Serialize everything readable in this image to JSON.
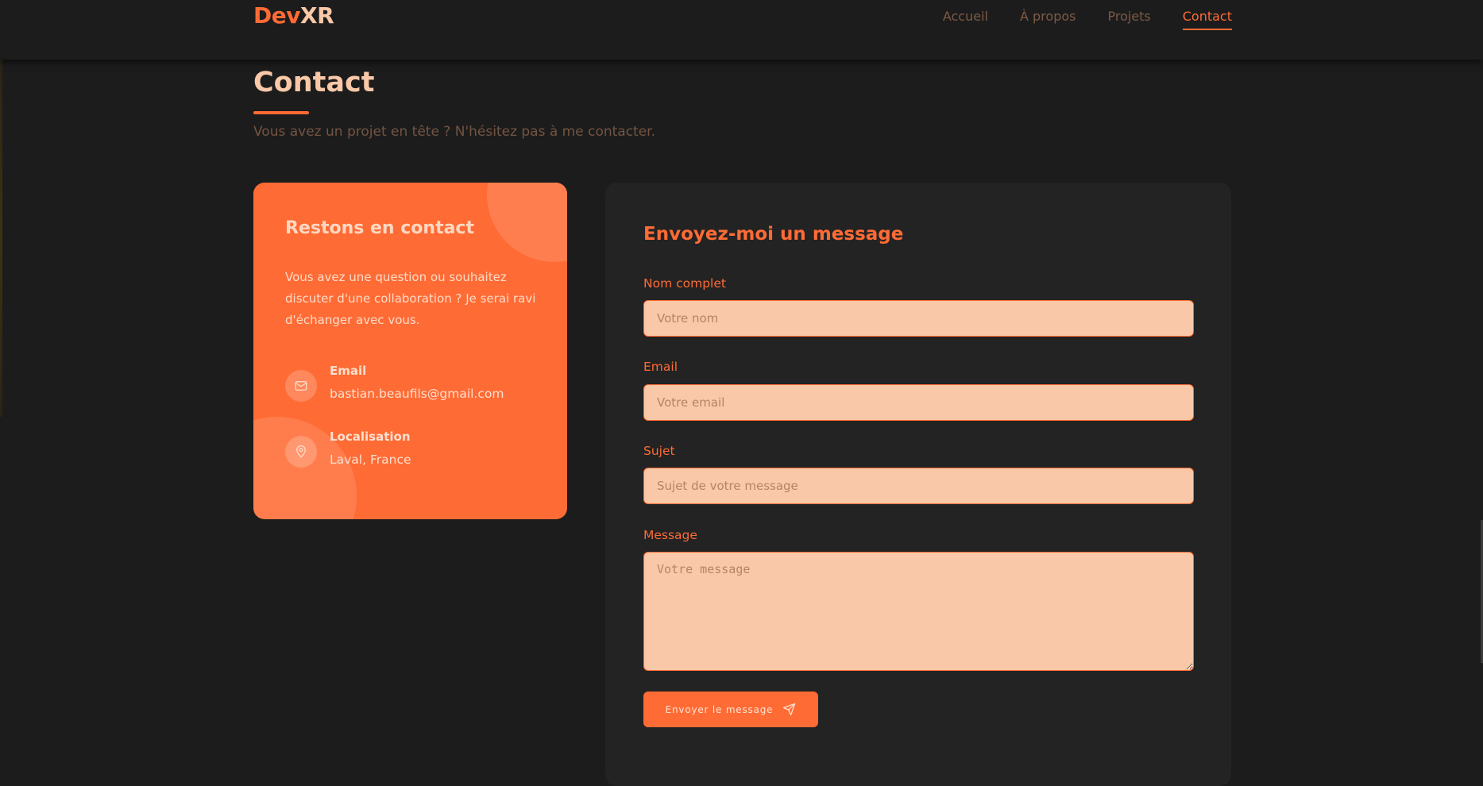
{
  "nav": {
    "logo_part1": "Dev",
    "logo_part2": "XR",
    "items": [
      {
        "label": "Accueil"
      },
      {
        "label": "À propos"
      },
      {
        "label": "Projets"
      },
      {
        "label": "Contact"
      }
    ],
    "active": "Contact"
  },
  "header": {
    "title": "Contact",
    "subtitle": "Vous avez un projet en tête ? N'hésitez pas à me contacter."
  },
  "info": {
    "title": "Restons en contact",
    "text": "Vous avez une question ou souhaitez discuter d'une collaboration ? Je serai ravi d'échanger avec vous.",
    "email_label": "Email",
    "email_value": "bastian.beaufils@gmail.com",
    "email_icon": "mail-icon",
    "location_label": "Localisation",
    "location_value": "Laval, France",
    "location_icon": "map-pin-icon"
  },
  "form": {
    "title": "Envoyez-moi un message",
    "name_label": "Nom complet",
    "name_placeholder": "Votre nom",
    "name_value": "",
    "email_label": "Email",
    "email_placeholder": "Votre email",
    "email_value": "",
    "subject_label": "Sujet",
    "subject_placeholder": "Sujet de votre message",
    "subject_value": "",
    "message_label": "Message",
    "message_placeholder": "Votre message",
    "message_value": "",
    "submit_label": "Envoyer le message",
    "submit_icon": "send-icon"
  },
  "colors": {
    "accent": "#ff6b35",
    "input_bg": "#f9c8a8",
    "page_bg": "#1c1c1c",
    "card_bg": "#232323"
  }
}
